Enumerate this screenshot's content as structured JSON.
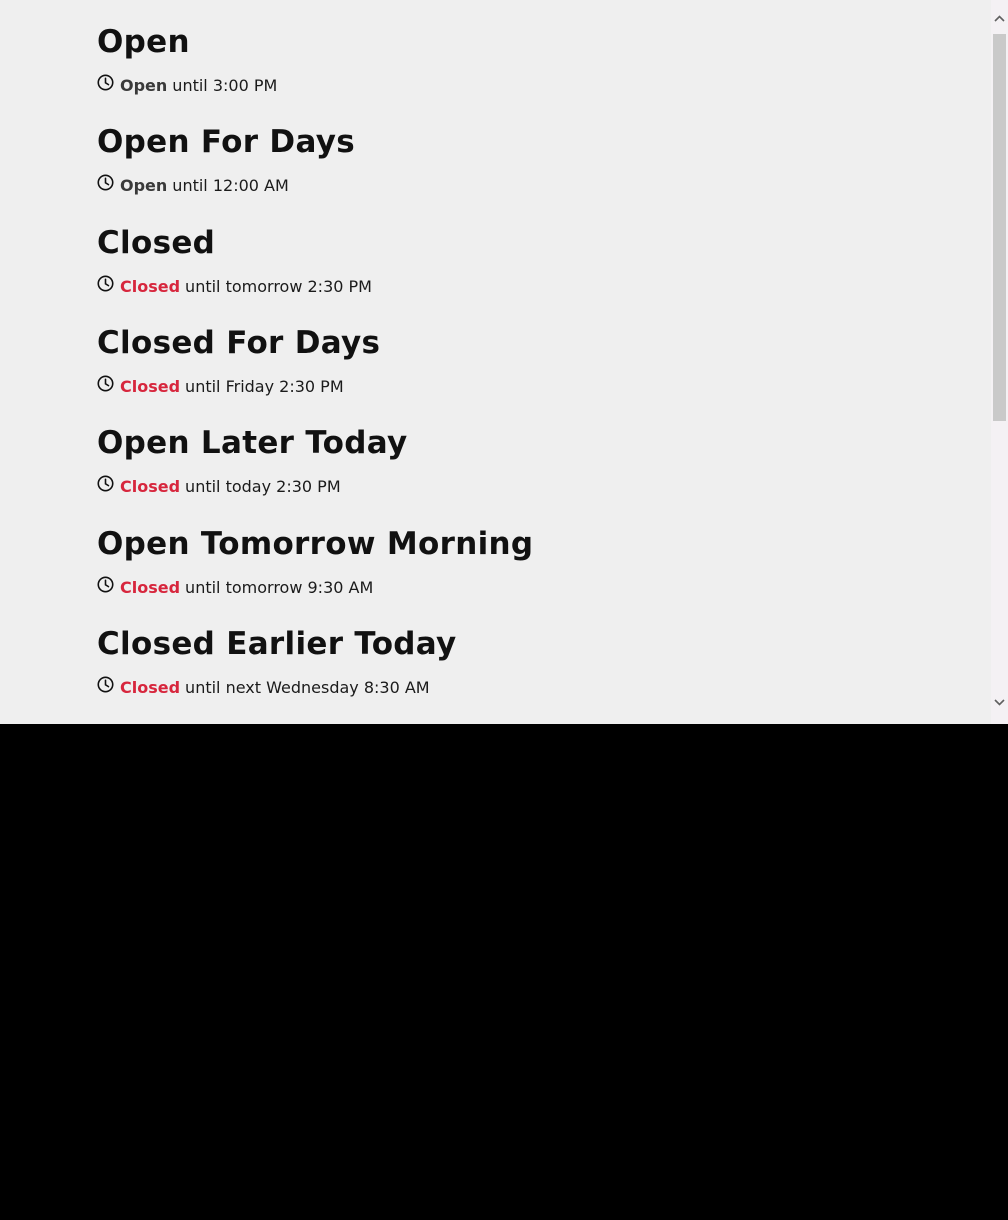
{
  "entries": [
    {
      "title": "Open",
      "status": "Open",
      "status_kind": "open",
      "detail": "until 3:00 PM"
    },
    {
      "title": "Open For Days",
      "status": "Open",
      "status_kind": "open",
      "detail": "until 12:00 AM"
    },
    {
      "title": "Closed",
      "status": "Closed",
      "status_kind": "closed",
      "detail": "until tomorrow 2:30 PM"
    },
    {
      "title": "Closed For Days",
      "status": "Closed",
      "status_kind": "closed",
      "detail": "until Friday 2:30 PM"
    },
    {
      "title": "Open Later Today",
      "status": "Closed",
      "status_kind": "closed",
      "detail": "until today 2:30 PM"
    },
    {
      "title": "Open Tomorrow Morning",
      "status": "Closed",
      "status_kind": "closed",
      "detail": "until tomorrow 9:30 AM"
    },
    {
      "title": "Closed Earlier Today",
      "status": "Closed",
      "status_kind": "closed",
      "detail": "until next Wednesday 8:30 AM"
    }
  ],
  "icons": {
    "status": "clock-icon",
    "scroll_up": "chevron-up-icon",
    "scroll_down": "chevron-down-icon"
  },
  "colors": {
    "page_background": "#efefef",
    "open_status": "#3a3a3a",
    "closed_status": "#d7263d",
    "text": "#111111"
  }
}
